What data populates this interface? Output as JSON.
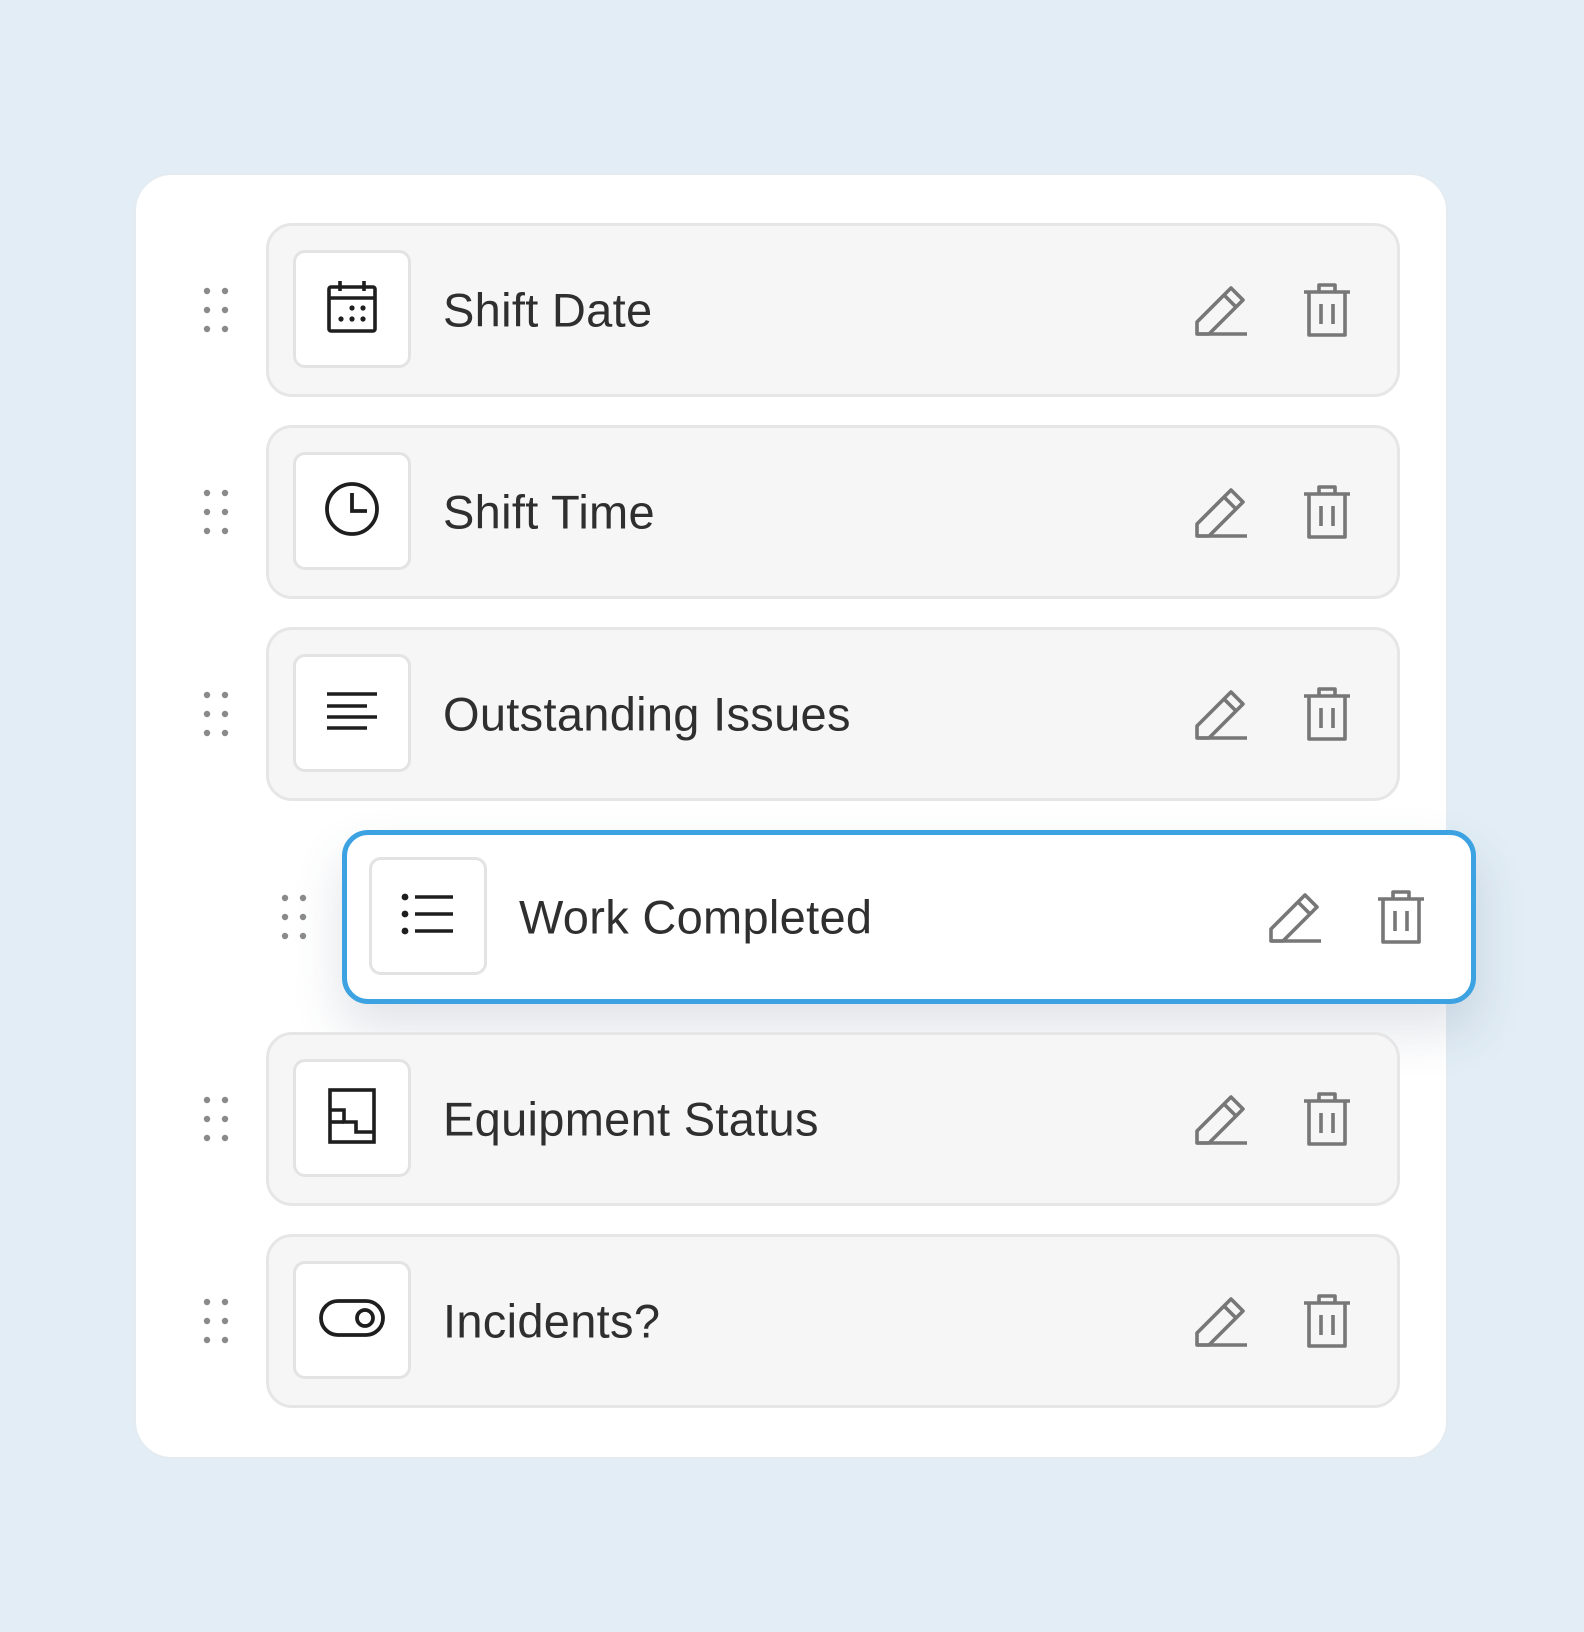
{
  "fields": [
    {
      "label": "Shift Date",
      "type_icon": "calendar-icon",
      "dragging": false
    },
    {
      "label": "Shift Time",
      "type_icon": "clock-icon",
      "dragging": false
    },
    {
      "label": "Outstanding Issues",
      "type_icon": "paragraph-icon",
      "dragging": false
    },
    {
      "label": "Work Completed",
      "type_icon": "bulleted-list-icon",
      "dragging": true
    },
    {
      "label": "Equipment Status",
      "type_icon": "layout-icon",
      "dragging": false
    },
    {
      "label": "Incidents?",
      "type_icon": "toggle-icon",
      "dragging": false
    }
  ],
  "actions": {
    "edit_icon": "pencil-icon",
    "delete_icon": "trash-icon"
  },
  "colors": {
    "background": "#e2edf5",
    "panel": "#ffffff",
    "row_background": "#f6f6f6",
    "drag_accent": "#3da2e1",
    "text": "#2f2f2f",
    "icon_muted": "#7a7a7a"
  }
}
